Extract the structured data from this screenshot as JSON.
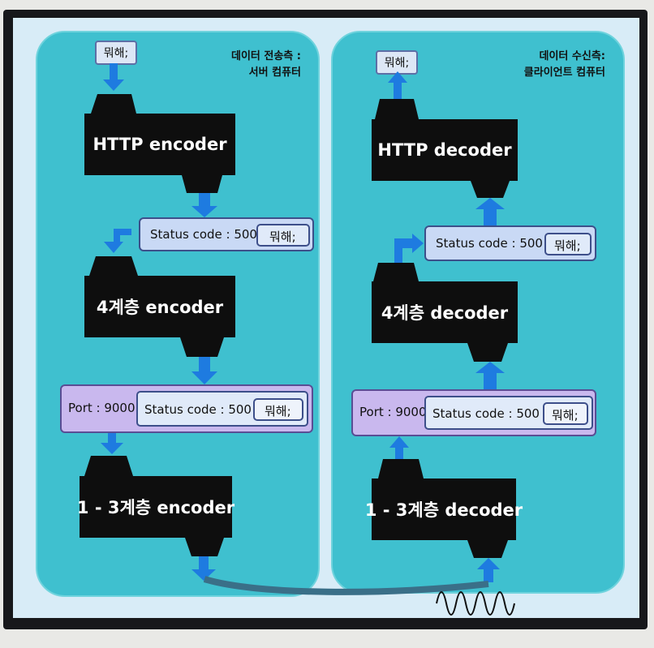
{
  "left": {
    "title_line1": "데이터 전송측 :",
    "title_line2": "서버 컴퓨터",
    "data_label": "뭐해;",
    "http_block": "HTTP encoder",
    "header1": {
      "status": "Status code : 500",
      "data": "뭐해;"
    },
    "transport_block": "4계층  encoder",
    "header2": {
      "port": "Port : 9000",
      "status": "Status code : 500",
      "data": "뭐해;"
    },
    "lower_block": "1 - 3계층 encoder"
  },
  "right": {
    "title_line1": "데이터 수신측:",
    "title_line2": "클라이언트 컴퓨터",
    "data_label": "뭐해;",
    "http_block": "HTTP  decoder",
    "header1": {
      "status": "Status code : 500",
      "data": "뭐해;"
    },
    "transport_block": "4계층  decoder",
    "header2": {
      "port": "Port : 9000",
      "status": "Status code : 500",
      "data": "뭐해;"
    },
    "lower_block": "1 - 3계층  decoder"
  },
  "colors": {
    "panel": "#3fc0cf",
    "block": "#0e0e0e",
    "arrow": "#1e7be0",
    "port_header": "#c9b8ee",
    "status_header": "#c9d9f5"
  }
}
